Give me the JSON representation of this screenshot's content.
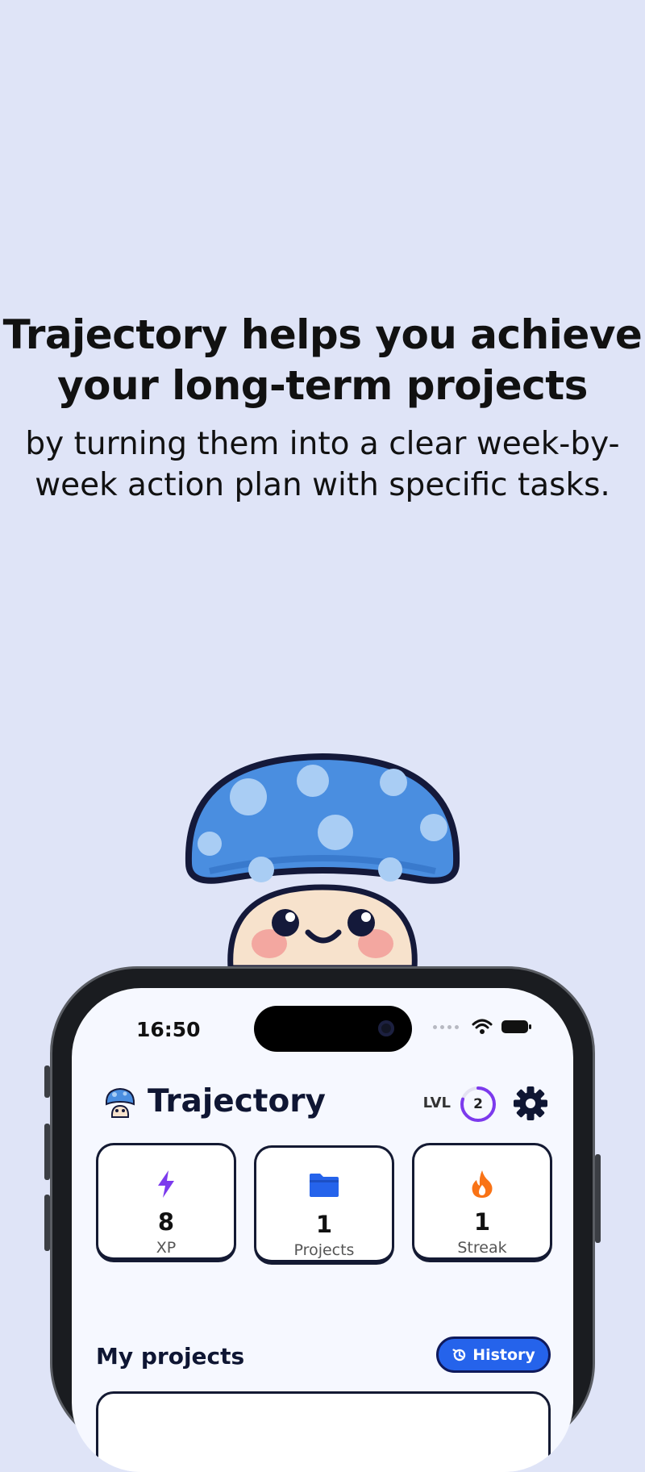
{
  "promo": {
    "headline_line1": "Trajectory helps you achieve",
    "headline_line2": "your long-term projects",
    "subline_line1": "by turning them into a clear week-by-",
    "subline_line2": "week action plan with specific tasks."
  },
  "status_bar": {
    "time": "16:50"
  },
  "app": {
    "title": "Trajectory",
    "level_label": "LVL",
    "level_value": "2",
    "level_progress": 0.8
  },
  "stats": [
    {
      "icon": "lightning-icon",
      "value": "8",
      "label": "XP"
    },
    {
      "icon": "folder-icon",
      "value": "1",
      "label": "Projects"
    },
    {
      "icon": "flame-icon",
      "value": "1",
      "label": "Streak"
    }
  ],
  "projects_section": {
    "title": "My projects",
    "history_label": "History"
  },
  "colors": {
    "background": "#dfe4f7",
    "accent_blue": "#2563eb",
    "xp_purple": "#7c3aed",
    "streak_orange": "#f97316",
    "mushroom_cap": "#4a8ee0"
  }
}
